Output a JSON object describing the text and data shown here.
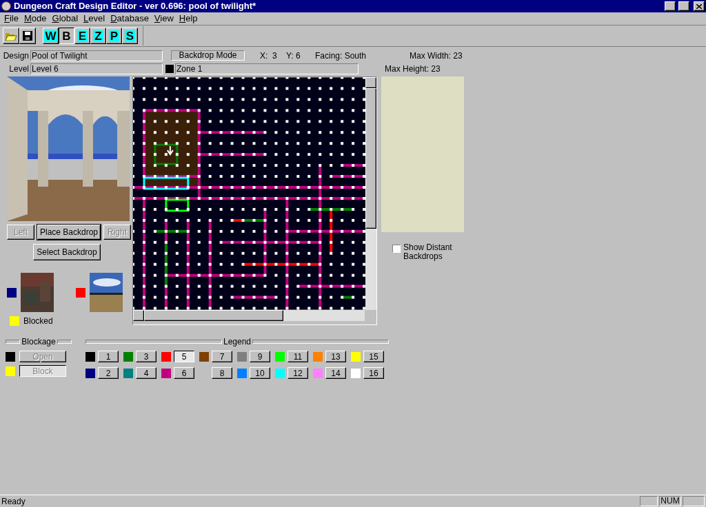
{
  "window": {
    "title": "Dungeon Craft Design Editor - ver 0.696: pool of twilight*"
  },
  "menu": [
    {
      "label": "File"
    },
    {
      "label": "Mode"
    },
    {
      "label": "Global"
    },
    {
      "label": "Level"
    },
    {
      "label": "Database"
    },
    {
      "label": "View"
    },
    {
      "label": "Help"
    }
  ],
  "toolbar": {
    "modes": [
      {
        "label": "W",
        "selected": false
      },
      {
        "label": "B",
        "selected": true
      },
      {
        "label": "E",
        "selected": false
      },
      {
        "label": "Z",
        "selected": false
      },
      {
        "label": "P",
        "selected": false
      },
      {
        "label": "S",
        "selected": false
      }
    ]
  },
  "header": {
    "design_label": "Design",
    "design_value": "Pool of Twilight",
    "mode": "Backdrop Mode",
    "x": "X:  3",
    "y": "Y: 6",
    "facing": "Facing: South",
    "max_width": "Max Width: 23",
    "level_label": "Level",
    "level_value": "Level 6",
    "zone": "Zone 1",
    "max_height": "Max Height: 23"
  },
  "nav_buttons": [
    {
      "label": "Left",
      "disabled": true,
      "default": false
    },
    {
      "label": "Place Backdrop",
      "disabled": false,
      "default": true
    },
    {
      "label": "Right",
      "disabled": true,
      "default": false
    }
  ],
  "select_backdrop": "Select Backdrop",
  "backdrops": [
    {
      "kind": "wall",
      "color": "#000080"
    },
    {
      "kind": "sky",
      "color": "#ff0000"
    }
  ],
  "blocked": {
    "label": "Blocked",
    "color": "#ffff00"
  },
  "blockage": {
    "title": "Blockage",
    "items": [
      {
        "label": "Open",
        "color": "#000000",
        "selected": false
      },
      {
        "label": "Block",
        "color": "#ffff00",
        "selected": true
      }
    ]
  },
  "legend": {
    "title": "Legend",
    "items": [
      {
        "label": "1",
        "color": "#000000",
        "selected": false
      },
      {
        "label": "2",
        "color": "#000080",
        "selected": false
      },
      {
        "label": "3",
        "color": "#008000",
        "selected": false
      },
      {
        "label": "4",
        "color": "#008080",
        "selected": false
      },
      {
        "label": "5",
        "color": "#ff0000",
        "selected": true
      },
      {
        "label": "6",
        "color": "#c00080",
        "selected": false
      },
      {
        "label": "7",
        "color": "#804000",
        "selected": false
      },
      {
        "label": "8",
        "selected": false
      },
      {
        "label": "9",
        "color": "#808080",
        "selected": false
      },
      {
        "label": "10",
        "color": "#0080ff",
        "selected": false
      },
      {
        "label": "11",
        "color": "#00ff00",
        "selected": false
      },
      {
        "label": "12",
        "color": "#00ffff",
        "selected": false
      },
      {
        "label": "13",
        "color": "#ff8000",
        "selected": false
      },
      {
        "label": "14",
        "color": "#ff80ff",
        "selected": false
      },
      {
        "label": "15",
        "color": "#ffff00",
        "selected": false
      },
      {
        "label": "16",
        "color": "#ffffff",
        "selected": false
      }
    ]
  },
  "show_distant": {
    "label": "Show Distant Backdrops",
    "checked": false
  },
  "status_bar": {
    "text": "Ready",
    "num": "NUM"
  }
}
